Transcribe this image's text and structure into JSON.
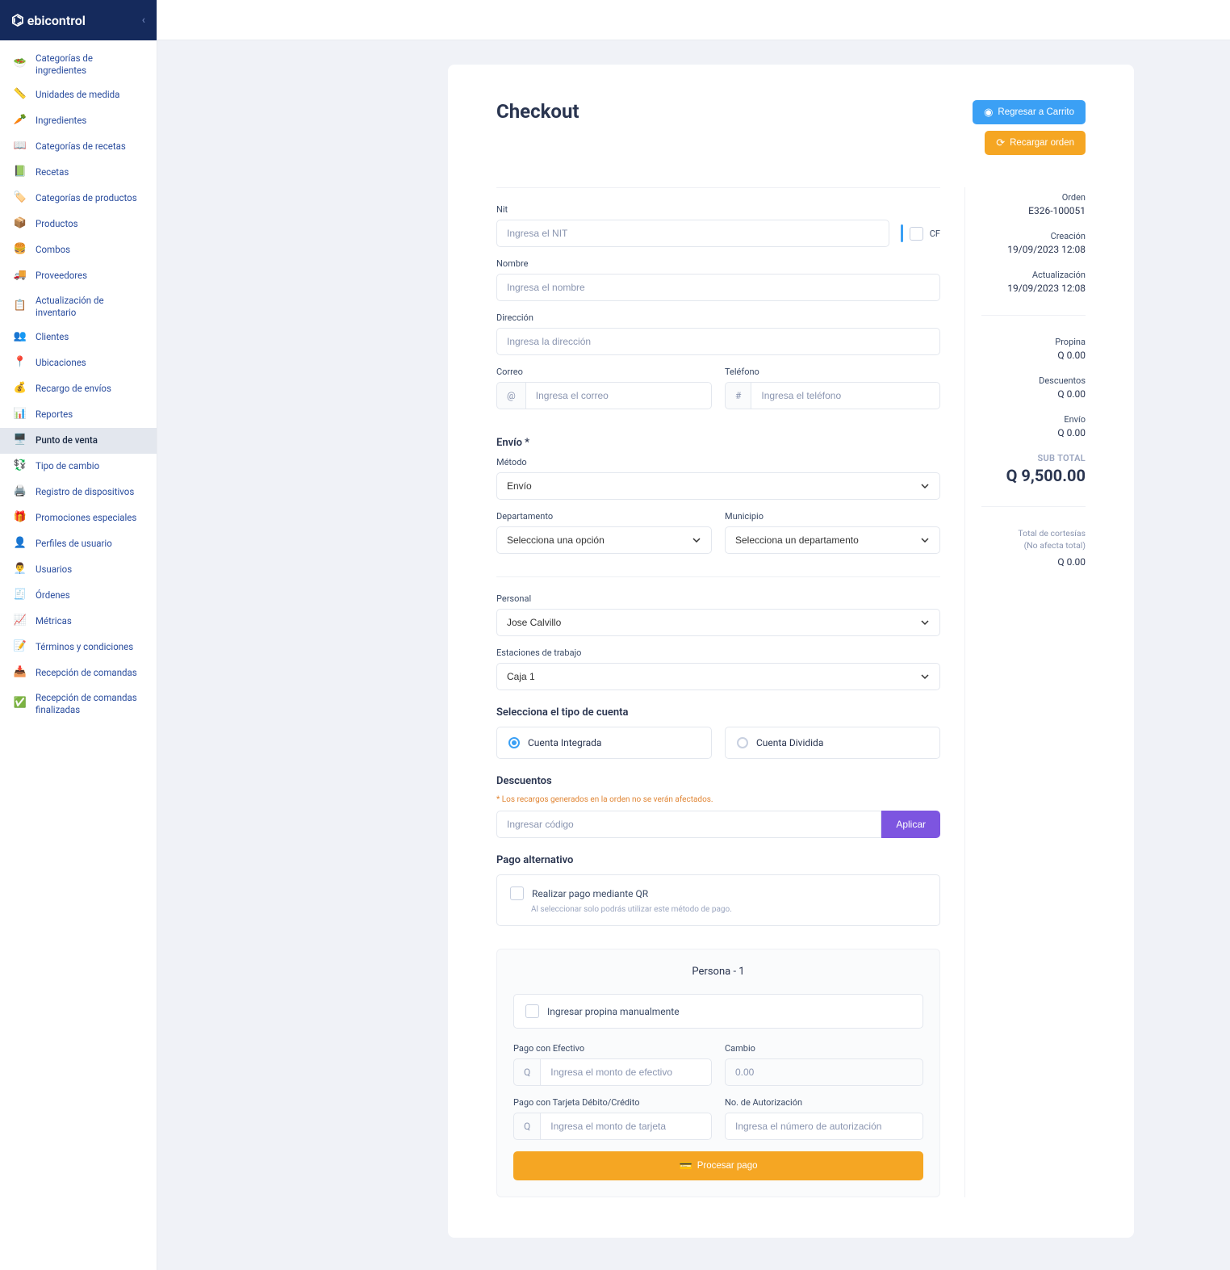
{
  "brand": "ebicontrol",
  "sidebar": {
    "items": [
      {
        "label": "Categorías de ingredientes",
        "icon": "🥗"
      },
      {
        "label": "Unidades de medida",
        "icon": "📏"
      },
      {
        "label": "Ingredientes",
        "icon": "🥕"
      },
      {
        "label": "Categorías de recetas",
        "icon": "📖"
      },
      {
        "label": "Recetas",
        "icon": "📗"
      },
      {
        "label": "Categorías de productos",
        "icon": "🏷️"
      },
      {
        "label": "Productos",
        "icon": "📦"
      },
      {
        "label": "Combos",
        "icon": "🍔"
      },
      {
        "label": "Proveedores",
        "icon": "🚚"
      },
      {
        "label": "Actualización de inventario",
        "icon": "📋"
      },
      {
        "label": "Clientes",
        "icon": "👥"
      },
      {
        "label": "Ubicaciones",
        "icon": "📍"
      },
      {
        "label": "Recargo de envíos",
        "icon": "💰"
      },
      {
        "label": "Reportes",
        "icon": "📊"
      },
      {
        "label": "Punto de venta",
        "icon": "🖥️",
        "active": true
      },
      {
        "label": "Tipo de cambio",
        "icon": "💱"
      },
      {
        "label": "Registro de dispositivos",
        "icon": "🖨️"
      },
      {
        "label": "Promociones especiales",
        "icon": "🎁"
      },
      {
        "label": "Perfiles de usuario",
        "icon": "👤"
      },
      {
        "label": "Usuarios",
        "icon": "👨‍💼"
      },
      {
        "label": "Órdenes",
        "icon": "🧾"
      },
      {
        "label": "Métricas",
        "icon": "📈"
      },
      {
        "label": "Términos y condiciones",
        "icon": "📝"
      },
      {
        "label": "Recepción de comandas",
        "icon": "📥"
      },
      {
        "label": "Recepción de comandas finalizadas",
        "icon": "✅"
      }
    ]
  },
  "page": {
    "title": "Checkout",
    "buttons": {
      "back": "Regresar a Carrito",
      "reload": "Recargar orden",
      "apply": "Aplicar",
      "process": "Procesar pago"
    }
  },
  "form": {
    "nit_label": "Nit",
    "nit_placeholder": "Ingresa el NIT",
    "cf_label": "CF",
    "nombre_label": "Nombre",
    "nombre_placeholder": "Ingresa el nombre",
    "direccion_label": "Dirección",
    "direccion_placeholder": "Ingresa la dirección",
    "correo_label": "Correo",
    "correo_placeholder": "Ingresa el correo",
    "correo_addon": "@",
    "telefono_label": "Teléfono",
    "telefono_placeholder": "Ingresa el teléfono",
    "telefono_addon": "#",
    "envio_title": "Envío *",
    "metodo_label": "Método",
    "metodo_value": "Envío",
    "departamento_label": "Departamento",
    "departamento_placeholder": "Selecciona una opción",
    "municipio_label": "Municipio",
    "municipio_placeholder": "Selecciona un departamento",
    "personal_label": "Personal",
    "personal_value": "Jose Calvillo",
    "estaciones_label": "Estaciones de trabajo",
    "estaciones_value": "Caja 1",
    "cuenta_title": "Selecciona el tipo de cuenta",
    "cuenta_integrada": "Cuenta Integrada",
    "cuenta_dividida": "Cuenta Dividida",
    "descuentos_title": "Descuentos",
    "descuentos_warn": "* Los recargos generados en la orden no se verán afectados.",
    "descuentos_placeholder": "Ingresar código",
    "altpay_title": "Pago alternativo",
    "altpay_qr": "Realizar pago mediante QR",
    "altpay_hint": "Al seleccionar solo podrás utilizar este método de pago.",
    "persona_title": "Persona - 1",
    "tip_manual": "Ingresar propina manualmente",
    "efectivo_label": "Pago con Efectivo",
    "efectivo_placeholder": "Ingresa el monto de efectivo",
    "efectivo_addon": "Q",
    "cambio_label": "Cambio",
    "cambio_value": "0.00",
    "tarjeta_label": "Pago con Tarjeta Débito/Crédito",
    "tarjeta_placeholder": "Ingresa el monto de tarjeta",
    "tarjeta_addon": "Q",
    "auth_label": "No. de Autorización",
    "auth_placeholder": "Ingresa el número de autorización"
  },
  "summary": {
    "orden_label": "Orden",
    "orden_value": "E326-100051",
    "creacion_label": "Creación",
    "creacion_value": "19/09/2023 12:08",
    "actualizacion_label": "Actualización",
    "actualizacion_value": "19/09/2023 12:08",
    "propina_label": "Propina",
    "propina_value": "Q 0.00",
    "descuentos_label": "Descuentos",
    "descuentos_value": "Q 0.00",
    "envio_label": "Envío",
    "envio_value": "Q 0.00",
    "subtotal_label": "SUB TOTAL",
    "subtotal_value": "Q 9,500.00",
    "cortesias_line1": "Total de cortesías",
    "cortesias_line2": "(No afecta total)",
    "cortesias_value": "Q 0.00"
  }
}
